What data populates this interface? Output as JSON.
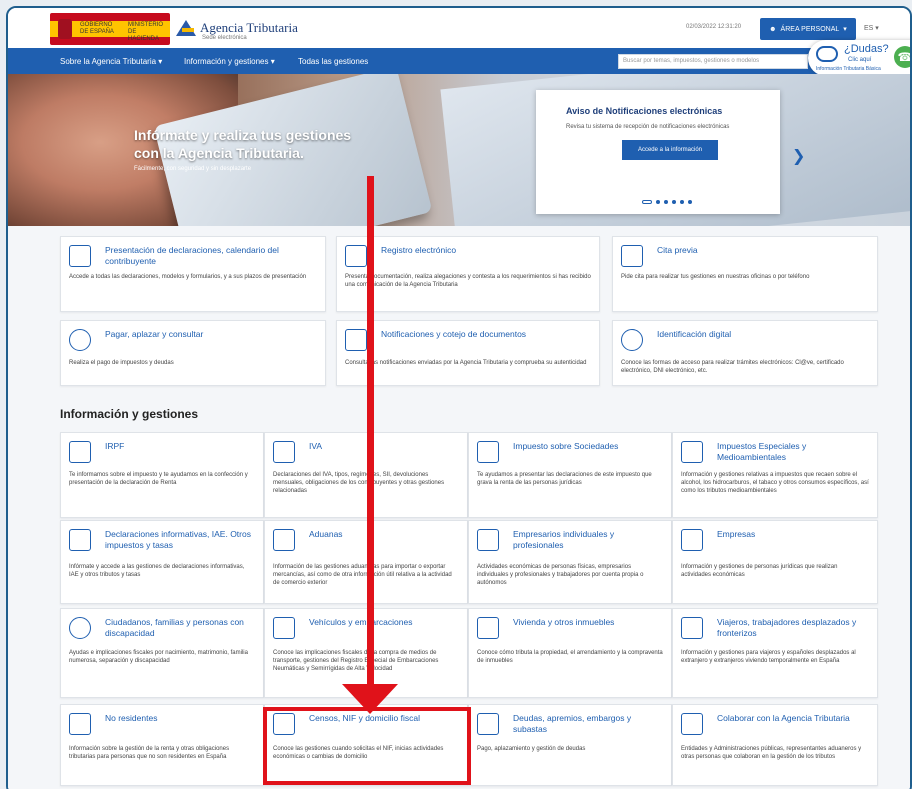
{
  "header": {
    "ministry_line1": "GOBIERNO DE ESPAÑA",
    "ministry_line2": "MINISTERIO DE HACIENDA",
    "logo_title": "Agencia Tributaria",
    "logo_subtitle": "Sede electrónica",
    "datetime": "02/03/2022 12:31:20",
    "area_personal": "ÁREA PERSONAL",
    "lang": "ES"
  },
  "nav": {
    "items": [
      "Sobre la Agencia Tributaria",
      "Información y gestiones",
      "Todas las gestiones"
    ],
    "search_placeholder": "Buscar por temas, impuestos, gestiones o modelos"
  },
  "help": {
    "question": "¿Dudas?",
    "click": "Clic aquí",
    "info": "Información Tributaria Básica"
  },
  "hero": {
    "title_line1": "Infórmate y realiza tus gestiones",
    "title_line2": "con la Agencia Tributaria.",
    "subtitle": "Fácilmente, con seguridad y sin desplazarte",
    "card_title": "Aviso de Notificaciones electrónicas",
    "card_desc": "Revisa tu sistema de recepción de notificaciones electrónicas",
    "card_button": "Accede a la información"
  },
  "quick": [
    {
      "title": "Presentación de declaraciones, calendario del contribuyente",
      "desc": "Accede a todas las declaraciones, modelos y formularios, y a sus plazos de presentación"
    },
    {
      "title": "Registro electrónico",
      "desc": "Presenta documentación, realiza alegaciones y contesta a los requerimientos si has recibido una comunicación de la Agencia Tributaria"
    },
    {
      "title": "Cita previa",
      "desc": "Pide cita para realizar tus gestiones en nuestras oficinas o por teléfono"
    },
    {
      "title": "Pagar, aplazar y consultar",
      "desc": "Realiza el pago de impuestos y deudas"
    },
    {
      "title": "Notificaciones y cotejo de documentos",
      "desc": "Consulta las notificaciones enviadas por la Agencia Tributaria y comprueba su autenticidad"
    },
    {
      "title": "Identificación digital",
      "desc": "Conoce las formas de acceso para realizar trámites electrónicos: Cl@ve, certificado electrónico, DNI electrónico, etc."
    }
  ],
  "section_title": "Información y gestiones",
  "grid": [
    {
      "title": "IRPF",
      "desc": "Te informamos sobre el impuesto y te ayudamos en la confección y presentación de la declaración de Renta"
    },
    {
      "title": "IVA",
      "desc": "Declaraciones del IVA, tipos, regímenes, SII, devoluciones mensuales, obligaciones de los contribuyentes y otras gestiones relacionadas"
    },
    {
      "title": "Impuesto sobre Sociedades",
      "desc": "Te ayudamos a presentar las declaraciones de este impuesto que grava la renta de las personas jurídicas"
    },
    {
      "title": "Impuestos Especiales y Medioambientales",
      "desc": "Información y gestiones relativas a impuestos que recaen sobre el alcohol, los hidrocarburos, el tabaco y otros consumos específicos, así como los tributos medioambientales"
    },
    {
      "title": "Declaraciones informativas, IAE. Otros impuestos y tasas",
      "desc": "Infórmate y accede a las gestiones de declaraciones informativas, IAE y otros tributos y tasas"
    },
    {
      "title": "Aduanas",
      "desc": "Información de las gestiones aduaneras para importar o exportar mercancías, así como de otra información útil relativa a la actividad de comercio exterior"
    },
    {
      "title": "Empresarios individuales y profesionales",
      "desc": "Actividades económicas de personas físicas, empresarios individuales y profesionales y trabajadores por cuenta propia o autónomos"
    },
    {
      "title": "Empresas",
      "desc": "Información y gestiones de personas jurídicas que realizan actividades económicas"
    },
    {
      "title": "Ciudadanos, familias y personas con discapacidad",
      "desc": "Ayudas e implicaciones fiscales por nacimiento, matrimonio, familia numerosa, separación y discapacidad"
    },
    {
      "title": "Vehículos y embarcaciones",
      "desc": "Conoce las implicaciones fiscales de la compra de medios de transporte, gestiones del Registro Especial de Embarcaciones Neumáticas y Semirrígidas de Alta Velocidad"
    },
    {
      "title": "Vivienda y otros inmuebles",
      "desc": "Conoce cómo tributa la propiedad, el arrendamiento y la compraventa de inmuebles"
    },
    {
      "title": "Viajeros, trabajadores desplazados y fronterizos",
      "desc": "Información y gestiones para viajeros y españoles desplazados al extranjero y extranjeros viviendo temporalmente en España"
    },
    {
      "title": "No residentes",
      "desc": "Información sobre la gestión de la renta y otras obligaciones tributarias para personas que no son residentes en España"
    },
    {
      "title": "Censos, NIF y domicilio fiscal",
      "desc": "Conoce las gestiones cuando solicitas el NIF, inicias actividades económicas o cambias de domicilio"
    },
    {
      "title": "Deudas, apremios, embargos y subastas",
      "desc": "Pago, aplazamiento y gestión de deudas"
    },
    {
      "title": "Colaborar con la Agencia Tributaria",
      "desc": "Entidades y Administraciones públicas, representantes aduaneros y otras personas que colaboran en la gestión de los tributos"
    }
  ]
}
